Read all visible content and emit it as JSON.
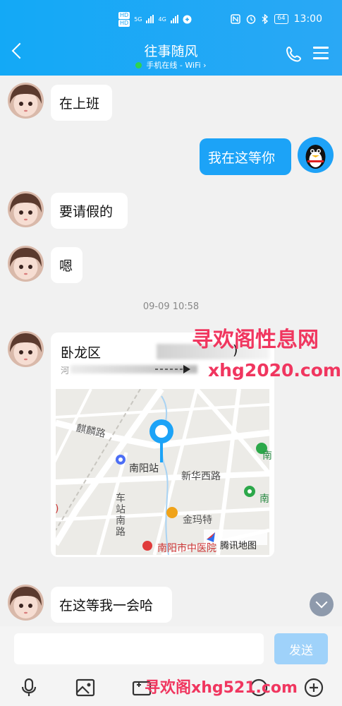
{
  "status_bar": {
    "sim_label_1": "HD",
    "sim_label_2": "HD",
    "net_1": "5G",
    "net_2": "4G",
    "battery": "64",
    "time": "13:00"
  },
  "header": {
    "title": "往事随风",
    "subtitle": "手机在线 - WiFi",
    "online_color": "#2ed34f"
  },
  "messages": [
    {
      "sender": "other",
      "text": "在上班"
    },
    {
      "sender": "me",
      "text": "我在这等你"
    },
    {
      "sender": "other",
      "text": "要请假的"
    },
    {
      "sender": "other",
      "text": "嗯"
    },
    {
      "timestamp": "09-09 10:58"
    },
    {
      "sender": "other",
      "type": "location",
      "location": {
        "title": "卧龙区",
        "title_suffix": ")",
        "address": "河",
        "map_labels": {
          "road_1": "麒麟路",
          "station": "南阳站",
          "road_2": "新华西路",
          "road_3a": "车",
          "road_3b": "站",
          "road_3c": "南",
          "road_3d": "路",
          "poi": "金玛特",
          "bottom": "南阳市中医院",
          "edge_1": "南",
          "edge_2": "南",
          "edge_left": ")",
          "brand": "腾讯地图"
        }
      }
    },
    {
      "sender": "other",
      "text": "在这等我一会哈"
    }
  ],
  "input": {
    "placeholder": "",
    "send_label": "发送"
  },
  "toolbar": {
    "icons": [
      "microphone-icon",
      "image-icon",
      "camera-icon",
      "sticker-icon",
      "add-icon"
    ]
  },
  "watermark": {
    "cn": "寻欢阁性息网",
    "url": "xhg2020.com",
    "bottom": "寻欢阁xhg521.com"
  },
  "colors": {
    "header": "#13a9f6",
    "my_bubble": "#1ca3f7",
    "send_button": "#9fd2fa",
    "watermark": "#f0365f"
  }
}
